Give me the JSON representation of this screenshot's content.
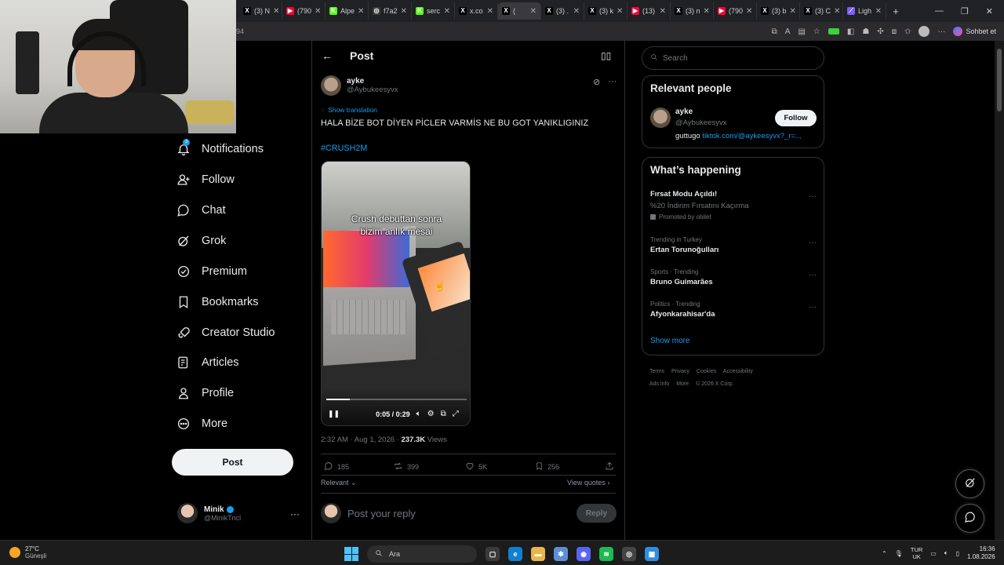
{
  "browser": {
    "tabs": [
      {
        "label": "(3) N",
        "fav": "X",
        "color": "#000000"
      },
      {
        "label": "(790",
        "fav": "▶",
        "color": "#ff0033"
      },
      {
        "label": "Alpe",
        "fav": "K",
        "color": "#53fc18"
      },
      {
        "label": "f7a2",
        "fav": "◎",
        "color": "#3a3a3a"
      },
      {
        "label": "serc",
        "fav": "K",
        "color": "#53fc18"
      },
      {
        "label": "x.co",
        "fav": "X",
        "color": "#000000"
      },
      {
        "label": "(",
        "fav": "X",
        "color": "#000000",
        "active": true
      },
      {
        "label": "(3) .",
        "fav": "X",
        "color": "#000000"
      },
      {
        "label": "(3) k",
        "fav": "X",
        "color": "#000000"
      },
      {
        "label": "(13)",
        "fav": "▶",
        "color": "#ff0033"
      },
      {
        "label": "(3) n",
        "fav": "X",
        "color": "#000000"
      },
      {
        "label": "(790",
        "fav": "▶",
        "color": "#ff0033"
      },
      {
        "label": "(3) b",
        "fav": "X",
        "color": "#000000"
      },
      {
        "label": "(3) C",
        "fav": "X",
        "color": "#000000"
      },
      {
        "label": "Ligh",
        "fav": "⟋",
        "color": "#7b5cff"
      }
    ],
    "address_fragment": "94",
    "chat_label": "Sohbet et"
  },
  "nav": {
    "items": [
      {
        "label": "Notifications",
        "icon": "bell-icon",
        "badge": "3"
      },
      {
        "label": "Follow",
        "icon": "person-add-icon"
      },
      {
        "label": "Chat",
        "icon": "chat-bubble-icon"
      },
      {
        "label": "Grok",
        "icon": "grok-icon"
      },
      {
        "label": "Premium",
        "icon": "premium-icon"
      },
      {
        "label": "Bookmarks",
        "icon": "bookmark-icon"
      },
      {
        "label": "Creator Studio",
        "icon": "rocket-icon"
      },
      {
        "label": "Articles",
        "icon": "article-icon"
      },
      {
        "label": "Profile",
        "icon": "person-icon"
      },
      {
        "label": "More",
        "icon": "more-circle-icon"
      }
    ],
    "post_button": "Post",
    "me": {
      "name": "Minik",
      "handle": "@MinikTncl"
    }
  },
  "main": {
    "header_title": "Post",
    "author": {
      "name": "ayke",
      "handle": "@Aybukeesyvx"
    },
    "show_translation": "Show translation",
    "text": "HALA BİZE BOT DİYEN PİCLER VARMİS NE BU GOT YANIKLIGINIZ",
    "hashtag": "#CRUSH2M",
    "video": {
      "caption_line1": "Crush debuttan sonra",
      "caption_line2": "bizim anlık mesai",
      "time": "0:05 / 0:29",
      "progress": 0.17
    },
    "meta": {
      "time": "2:32 AM · Aug 1, 2026 · ",
      "views_count": "237.3K",
      "views_label": " Views"
    },
    "actions": {
      "replies": "185",
      "reposts": "399",
      "likes": "5K",
      "bookmarks": "256"
    },
    "relevant": "Relevant",
    "view_quotes": "View quotes",
    "reply_placeholder": "Post your reply",
    "reply_button": "Reply"
  },
  "right": {
    "search_placeholder": "Search",
    "relevant_people": {
      "title": "Relevant people",
      "name": "ayke",
      "handle": "@Aybukeesyvx",
      "follow": "Follow",
      "bio_text": "guttugo ",
      "bio_link": "tiktok.com/@aykeesyvx?_r=..."
    },
    "happening": {
      "title": "What’s happening",
      "promo": {
        "title": "Fırsat Modu Açıldı!",
        "sub": "%20 İndirim Fırsatını Kaçırma",
        "promoted": "Promoted by obilet"
      },
      "trends": [
        {
          "cat": "Trending in Turkey",
          "title": "Ertan Torunoğulları"
        },
        {
          "cat": "Sports · Trending",
          "title": "Bruno Guimarães"
        },
        {
          "cat": "Politics · Trending",
          "title": "Afyonkarahisar'da"
        }
      ],
      "show_more": "Show more"
    },
    "footer": [
      "Terms",
      "Privacy",
      "Cookies",
      "Accessibility",
      "Ads info",
      "More",
      "© 2026 X Corp."
    ]
  },
  "taskbar": {
    "temp": "27°C",
    "weather": "Güneşli",
    "search": "Ara",
    "lang1": "TUR",
    "lang2": "UK",
    "time": "16:36",
    "date": "1.08.2026"
  }
}
